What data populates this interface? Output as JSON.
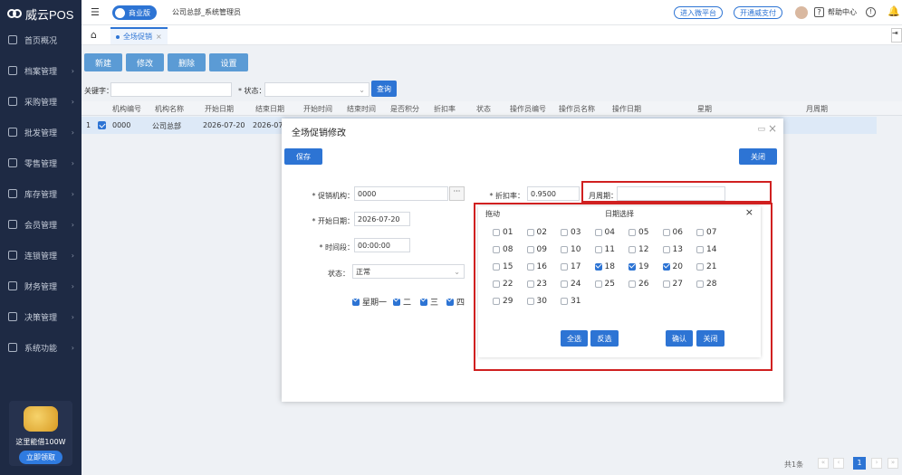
{
  "app": {
    "logo_text": "威云POS",
    "edition_badge": "商业版",
    "org_user": "公司总部_系统管理员",
    "btn_enter_wholesale": "进入微平台",
    "btn_open_pay": "开通威支付",
    "help_center": "帮助中心"
  },
  "sidebar": {
    "items": [
      {
        "label": "首页概况",
        "icon": "home-icon"
      },
      {
        "label": "档案管理",
        "icon": "folder-icon"
      },
      {
        "label": "采购管理",
        "icon": "cart-icon"
      },
      {
        "label": "批发管理",
        "icon": "building-icon"
      },
      {
        "label": "零售管理",
        "icon": "store-icon"
      },
      {
        "label": "库存管理",
        "icon": "box-icon"
      },
      {
        "label": "会员管理",
        "icon": "member-icon"
      },
      {
        "label": "连锁管理",
        "icon": "chain-icon"
      },
      {
        "label": "财务管理",
        "icon": "money-icon"
      },
      {
        "label": "决策管理",
        "icon": "chart-icon"
      },
      {
        "label": "系统功能",
        "icon": "gear-icon"
      }
    ],
    "promo_text": "这里能借100W",
    "promo_button": "立即领取"
  },
  "tabs": [
    {
      "label": "全场促销"
    }
  ],
  "toolbar": {
    "new": "新建",
    "edit": "修改",
    "delete": "删除",
    "settings": "设置"
  },
  "filter": {
    "keyword_label": "关键字：",
    "status_label": "* 状态：",
    "query": "查询"
  },
  "table": {
    "columns": [
      "机构编号",
      "机构名称",
      "开始日期",
      "结束日期",
      "开始时间",
      "结束时间",
      "是否积分",
      "折扣率",
      "状态",
      "操作员编号",
      "操作员名称",
      "操作日期",
      "星期",
      "月周期"
    ],
    "rows": [
      {
        "index": "1",
        "code": "0000",
        "name": "公司总部",
        "start": "2026-07-20",
        "end": "2026-07"
      }
    ]
  },
  "modal": {
    "title": "全场促销修改",
    "save": "保存",
    "close": "关闭",
    "org_label": "* 促销机构：",
    "org_value": "0000",
    "start_label": "* 开始日期：",
    "start_value": "2026-07-20",
    "time_label": "* 时间段：",
    "time_value": "00:00:00",
    "status_label": "状态：",
    "status_value": "正常",
    "discount_label": "* 折扣率：",
    "discount_value": "0.9500",
    "month_label": "月周期：",
    "weekdays": [
      "星期一",
      "二",
      "三",
      "四"
    ]
  },
  "picker": {
    "drag": "拖动",
    "title": "日期选择",
    "days": [
      "01",
      "02",
      "03",
      "04",
      "05",
      "06",
      "07",
      "08",
      "09",
      "10",
      "11",
      "12",
      "13",
      "14",
      "15",
      "16",
      "17",
      "18",
      "19",
      "20",
      "21",
      "22",
      "23",
      "24",
      "25",
      "26",
      "27",
      "28",
      "29",
      "30",
      "31"
    ],
    "checked": [
      18,
      19,
      20
    ],
    "select_all": "全选",
    "invert": "反选",
    "confirm": "确认",
    "close": "关闭"
  },
  "footer": {
    "total": "共1条",
    "page": "1"
  }
}
